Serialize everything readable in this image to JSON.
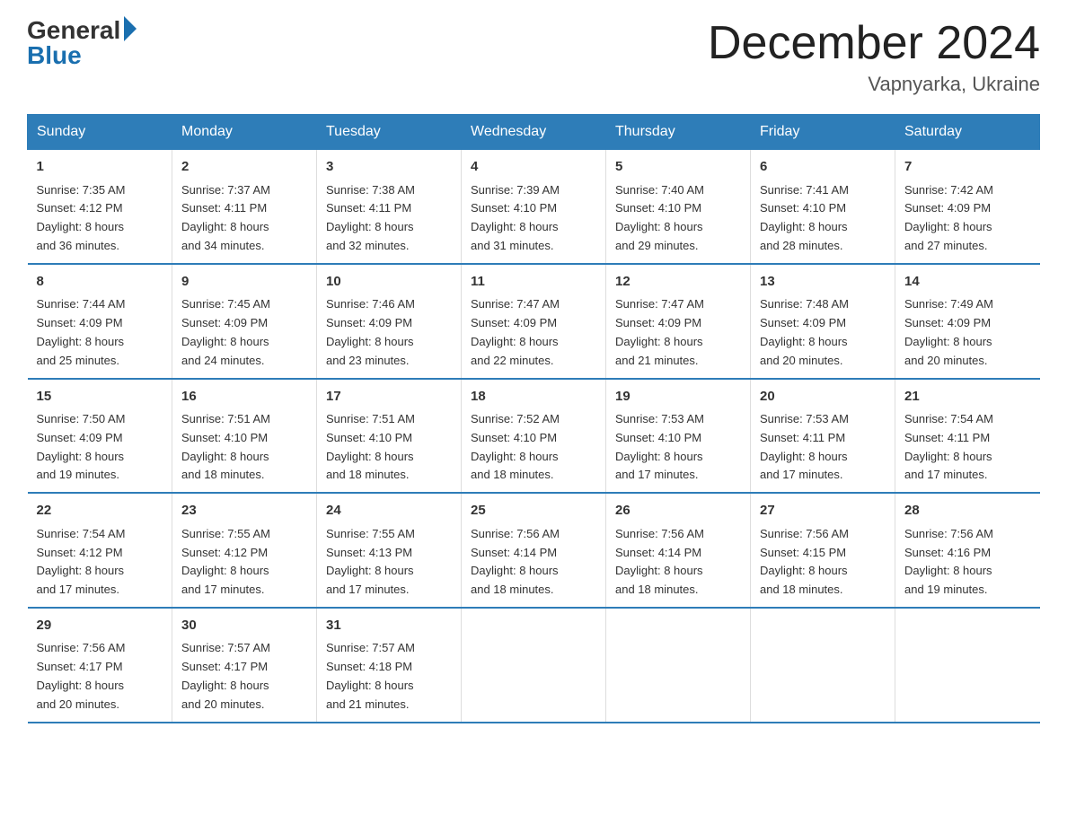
{
  "logo": {
    "general": "General",
    "blue": "Blue"
  },
  "title": "December 2024",
  "location": "Vapnyarka, Ukraine",
  "days_of_week": [
    "Sunday",
    "Monday",
    "Tuesday",
    "Wednesday",
    "Thursday",
    "Friday",
    "Saturday"
  ],
  "weeks": [
    [
      {
        "day": "1",
        "sunrise": "7:35 AM",
        "sunset": "4:12 PM",
        "daylight": "8 hours and 36 minutes."
      },
      {
        "day": "2",
        "sunrise": "7:37 AM",
        "sunset": "4:11 PM",
        "daylight": "8 hours and 34 minutes."
      },
      {
        "day": "3",
        "sunrise": "7:38 AM",
        "sunset": "4:11 PM",
        "daylight": "8 hours and 32 minutes."
      },
      {
        "day": "4",
        "sunrise": "7:39 AM",
        "sunset": "4:10 PM",
        "daylight": "8 hours and 31 minutes."
      },
      {
        "day": "5",
        "sunrise": "7:40 AM",
        "sunset": "4:10 PM",
        "daylight": "8 hours and 29 minutes."
      },
      {
        "day": "6",
        "sunrise": "7:41 AM",
        "sunset": "4:10 PM",
        "daylight": "8 hours and 28 minutes."
      },
      {
        "day": "7",
        "sunrise": "7:42 AM",
        "sunset": "4:09 PM",
        "daylight": "8 hours and 27 minutes."
      }
    ],
    [
      {
        "day": "8",
        "sunrise": "7:44 AM",
        "sunset": "4:09 PM",
        "daylight": "8 hours and 25 minutes."
      },
      {
        "day": "9",
        "sunrise": "7:45 AM",
        "sunset": "4:09 PM",
        "daylight": "8 hours and 24 minutes."
      },
      {
        "day": "10",
        "sunrise": "7:46 AM",
        "sunset": "4:09 PM",
        "daylight": "8 hours and 23 minutes."
      },
      {
        "day": "11",
        "sunrise": "7:47 AM",
        "sunset": "4:09 PM",
        "daylight": "8 hours and 22 minutes."
      },
      {
        "day": "12",
        "sunrise": "7:47 AM",
        "sunset": "4:09 PM",
        "daylight": "8 hours and 21 minutes."
      },
      {
        "day": "13",
        "sunrise": "7:48 AM",
        "sunset": "4:09 PM",
        "daylight": "8 hours and 20 minutes."
      },
      {
        "day": "14",
        "sunrise": "7:49 AM",
        "sunset": "4:09 PM",
        "daylight": "8 hours and 20 minutes."
      }
    ],
    [
      {
        "day": "15",
        "sunrise": "7:50 AM",
        "sunset": "4:09 PM",
        "daylight": "8 hours and 19 minutes."
      },
      {
        "day": "16",
        "sunrise": "7:51 AM",
        "sunset": "4:10 PM",
        "daylight": "8 hours and 18 minutes."
      },
      {
        "day": "17",
        "sunrise": "7:51 AM",
        "sunset": "4:10 PM",
        "daylight": "8 hours and 18 minutes."
      },
      {
        "day": "18",
        "sunrise": "7:52 AM",
        "sunset": "4:10 PM",
        "daylight": "8 hours and 18 minutes."
      },
      {
        "day": "19",
        "sunrise": "7:53 AM",
        "sunset": "4:10 PM",
        "daylight": "8 hours and 17 minutes."
      },
      {
        "day": "20",
        "sunrise": "7:53 AM",
        "sunset": "4:11 PM",
        "daylight": "8 hours and 17 minutes."
      },
      {
        "day": "21",
        "sunrise": "7:54 AM",
        "sunset": "4:11 PM",
        "daylight": "8 hours and 17 minutes."
      }
    ],
    [
      {
        "day": "22",
        "sunrise": "7:54 AM",
        "sunset": "4:12 PM",
        "daylight": "8 hours and 17 minutes."
      },
      {
        "day": "23",
        "sunrise": "7:55 AM",
        "sunset": "4:12 PM",
        "daylight": "8 hours and 17 minutes."
      },
      {
        "day": "24",
        "sunrise": "7:55 AM",
        "sunset": "4:13 PM",
        "daylight": "8 hours and 17 minutes."
      },
      {
        "day": "25",
        "sunrise": "7:56 AM",
        "sunset": "4:14 PM",
        "daylight": "8 hours and 18 minutes."
      },
      {
        "day": "26",
        "sunrise": "7:56 AM",
        "sunset": "4:14 PM",
        "daylight": "8 hours and 18 minutes."
      },
      {
        "day": "27",
        "sunrise": "7:56 AM",
        "sunset": "4:15 PM",
        "daylight": "8 hours and 18 minutes."
      },
      {
        "day": "28",
        "sunrise": "7:56 AM",
        "sunset": "4:16 PM",
        "daylight": "8 hours and 19 minutes."
      }
    ],
    [
      {
        "day": "29",
        "sunrise": "7:56 AM",
        "sunset": "4:17 PM",
        "daylight": "8 hours and 20 minutes."
      },
      {
        "day": "30",
        "sunrise": "7:57 AM",
        "sunset": "4:17 PM",
        "daylight": "8 hours and 20 minutes."
      },
      {
        "day": "31",
        "sunrise": "7:57 AM",
        "sunset": "4:18 PM",
        "daylight": "8 hours and 21 minutes."
      },
      {
        "day": "",
        "sunrise": "",
        "sunset": "",
        "daylight": ""
      },
      {
        "day": "",
        "sunrise": "",
        "sunset": "",
        "daylight": ""
      },
      {
        "day": "",
        "sunrise": "",
        "sunset": "",
        "daylight": ""
      },
      {
        "day": "",
        "sunrise": "",
        "sunset": "",
        "daylight": ""
      }
    ]
  ],
  "labels": {
    "sunrise_prefix": "Sunrise: ",
    "sunset_prefix": "Sunset: ",
    "daylight_prefix": "Daylight: "
  }
}
